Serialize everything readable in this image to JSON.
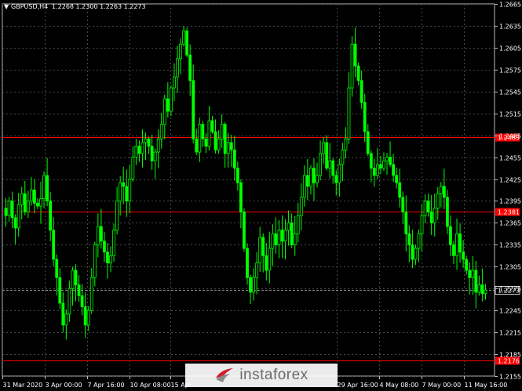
{
  "header": {
    "symbol": "GBPUSD,H4",
    "ohlc": "1.2268 1.2300 1.2263 1.2273"
  },
  "watermark": {
    "brand": "instaforex"
  },
  "colors": {
    "background": "#000000",
    "grid": "#4a4a4a",
    "candle": "#00ff00",
    "level": "#ff0000",
    "current": "#8a8a8a"
  },
  "chart_data": {
    "type": "candlestick",
    "ylim": [
      1.2155,
      1.2665
    ],
    "yticks": [
      1.2155,
      1.2185,
      1.2215,
      1.2245,
      1.2275,
      1.2305,
      1.2335,
      1.2365,
      1.2395,
      1.2425,
      1.2455,
      1.2485,
      1.2515,
      1.2545,
      1.2575,
      1.2605,
      1.2635,
      1.2665
    ],
    "xticks": [
      "31 Mar 2020",
      "3 Apr 00:00",
      "7 Apr 16:00",
      "10 Apr 08:00",
      "15 Apr",
      "29 Apr 16:00",
      "4 May 08:00",
      "7 May 00:00",
      "11 May 16:00"
    ],
    "levels": [
      {
        "label": "1.2483",
        "value": 1.2483
      },
      {
        "label": "1.2381",
        "value": 1.2381
      },
      {
        "label": "1.2176",
        "value": 1.2176
      }
    ],
    "current": {
      "label": "1.2273",
      "value": 1.2273
    },
    "close_path": [
      1.2375,
      1.2395,
      1.2372,
      1.2358,
      1.239,
      1.2405,
      1.238,
      1.2395,
      1.241,
      1.2392,
      1.2388,
      1.2398,
      1.243,
      1.2395,
      1.2355,
      1.2315,
      1.229,
      1.2255,
      1.2225,
      1.224,
      1.2275,
      1.23,
      1.228,
      1.2265,
      1.225,
      1.2225,
      1.2245,
      1.229,
      1.2335,
      1.236,
      1.234,
      1.2325,
      1.231,
      1.232,
      1.2355,
      1.2395,
      1.242,
      1.2415,
      1.2395,
      1.2425,
      1.2455,
      1.247,
      1.246,
      1.2475,
      1.248,
      1.247,
      1.245,
      1.2462,
      1.248,
      1.25,
      1.2535,
      1.2518,
      1.255,
      1.2565,
      1.259,
      1.261,
      1.2628,
      1.2595,
      1.256,
      1.248,
      1.2462,
      1.25,
      1.248,
      1.247,
      1.2505,
      1.249,
      1.2465,
      1.248,
      1.25,
      1.246,
      1.2475,
      1.2465,
      1.244,
      1.242,
      1.238,
      1.233,
      1.229,
      1.227,
      1.229,
      1.231,
      1.2345,
      1.232,
      1.23,
      1.233,
      1.235,
      1.2335,
      1.2355,
      1.234,
      1.2355,
      1.2365,
      1.2335,
      1.235,
      1.2375,
      1.24,
      1.243,
      1.2415,
      1.244,
      1.242,
      1.243,
      1.246,
      1.2475,
      1.244,
      1.245,
      1.243,
      1.242,
      1.2445,
      1.2465,
      1.248,
      1.255,
      1.261,
      1.258,
      1.256,
      1.253,
      1.249,
      1.246,
      1.244,
      1.243,
      1.2445,
      1.244,
      1.245,
      1.2455,
      1.2445,
      1.243,
      1.242,
      1.24,
      1.238,
      1.235,
      1.2335,
      1.2315,
      1.233,
      1.235,
      1.2375,
      1.2395,
      1.238,
      1.2365,
      1.2385,
      1.2405,
      1.2415,
      1.24,
      1.236,
      1.2335,
      1.232,
      1.235,
      1.2325,
      1.2315,
      1.23,
      1.229,
      1.23,
      1.227,
      1.228,
      1.2268,
      1.2273
    ]
  }
}
